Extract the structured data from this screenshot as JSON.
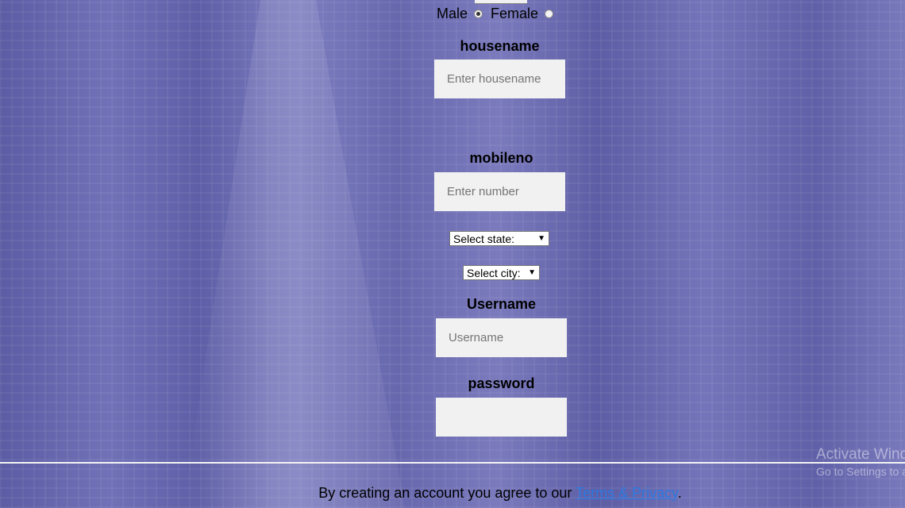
{
  "gender": {
    "male_label": "Male",
    "female_label": "Female",
    "selected": "male"
  },
  "housename": {
    "label": "housename",
    "placeholder": "Enter housename"
  },
  "mobileno": {
    "label": "mobileno",
    "placeholder": "Enter number"
  },
  "state_select": {
    "value": "Select state:"
  },
  "city_select": {
    "value": "Select city:"
  },
  "username": {
    "label": "Username",
    "placeholder": "Username"
  },
  "password": {
    "label": "password",
    "placeholder": ""
  },
  "footer": {
    "text_prefix": "By creating an account you agree to our ",
    "link_text": "Terms & Privacy",
    "text_suffix": "."
  },
  "watermark": {
    "line1": "Activate Windows",
    "line2": "Go to Settings to activate Windows."
  },
  "colors": {
    "background_tint": "#6b6bb2",
    "input_bg": "#f1f1f1",
    "link": "#2a7ae2"
  }
}
